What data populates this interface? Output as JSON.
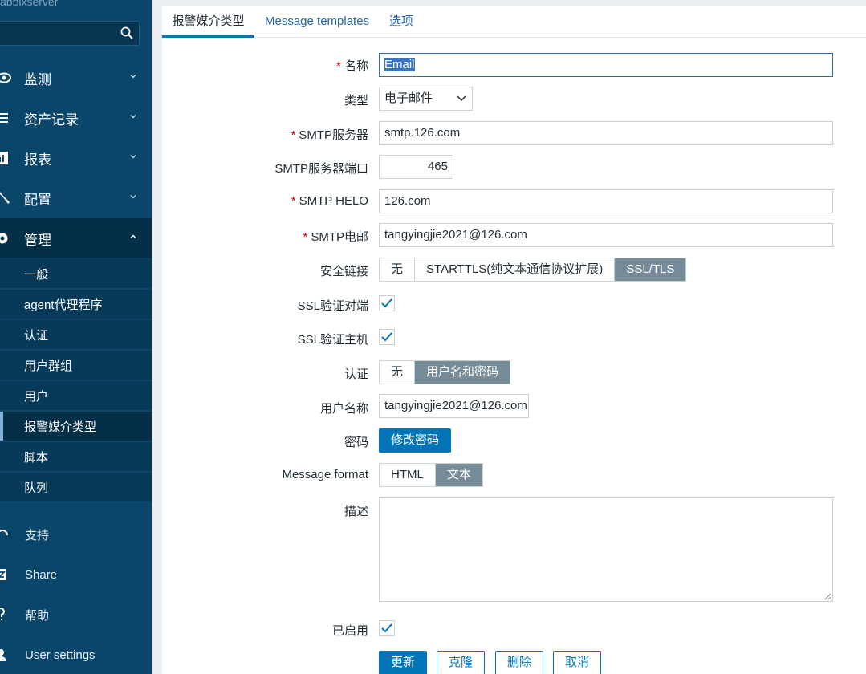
{
  "sidebar": {
    "server_name": "abbixserver",
    "search_placeholder": "",
    "menu": [
      {
        "label": "监测",
        "icon": "eye-icon"
      },
      {
        "label": "资产记录",
        "icon": "list-icon"
      },
      {
        "label": "报表",
        "icon": "bar-chart-icon"
      },
      {
        "label": "配置",
        "icon": "wrench-icon"
      },
      {
        "label": "管理",
        "icon": "gear-icon"
      }
    ],
    "submenu": [
      "一般",
      "agent代理程序",
      "认证",
      "用户群组",
      "用户",
      "报警媒介类型",
      "脚本",
      "队列"
    ],
    "bottom": [
      {
        "label": "支持",
        "icon": "headset-icon"
      },
      {
        "label": "Share",
        "icon": "share-icon"
      },
      {
        "label": "帮助",
        "icon": "help-icon"
      },
      {
        "label": "User settings",
        "icon": "user-icon"
      }
    ]
  },
  "tabs": [
    "报警媒介类型",
    "Message templates",
    "选项"
  ],
  "form": {
    "name_label": "名称",
    "name_value": "Email",
    "type_label": "类型",
    "type_value": "电子邮件",
    "smtp_server_label": "SMTP服务器",
    "smtp_server_value": "smtp.126.com",
    "smtp_port_label": "SMTP服务器端口",
    "smtp_port_value": "465",
    "smtp_helo_label": "SMTP HELO",
    "smtp_helo_value": "126.com",
    "smtp_email_label": "SMTP电邮",
    "smtp_email_value": "tangyingjie2021@126.com",
    "security_label": "安全链接",
    "security_options": [
      "无",
      "STARTTLS(纯文本通信协议扩展)",
      "SSL/TLS"
    ],
    "ssl_verify_peer_label": "SSL验证对端",
    "ssl_verify_host_label": "SSL验证主机",
    "auth_label": "认证",
    "auth_options": [
      "无",
      "用户名和密码"
    ],
    "username_label": "用户名称",
    "username_value": "tangyingjie2021@126.com",
    "password_label": "密码",
    "change_password_button": "修改密码",
    "message_format_label": "Message format",
    "message_format_options": [
      "HTML",
      "文本"
    ],
    "description_label": "描述",
    "enabled_label": "已启用",
    "required_mark": "*"
  },
  "buttons": {
    "update": "更新",
    "clone": "克隆",
    "delete": "删除",
    "cancel": "取消"
  },
  "colors": {
    "sidebar_bg": "#0a466a",
    "primary": "#0275b8",
    "segment_selected": "#768d99"
  }
}
